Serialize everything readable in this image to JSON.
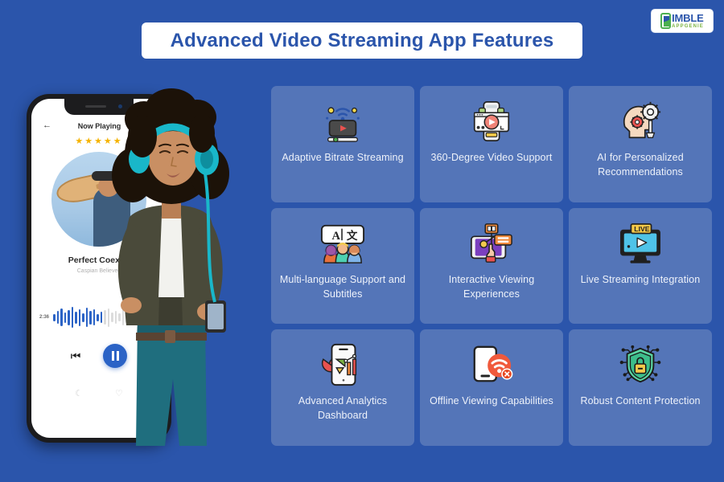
{
  "page": {
    "background_color": "#2B55AB",
    "card_color": "#5475B8",
    "accent_color": "#2B63C6"
  },
  "logo": {
    "name": "nimble-appgenie-logo",
    "main_text": "IMBLE",
    "sub_text": "APPGENIE",
    "icon": "phone-n-icon"
  },
  "header": {
    "title": "Advanced Video Streaming App Features"
  },
  "phone": {
    "topbar": {
      "back_icon": "back-arrow-icon",
      "back_glyph": "←",
      "title": "Now Playing",
      "favorite_icon": "heart-outline-icon",
      "favorite_glyph": "♡"
    },
    "rating": {
      "stars": "★★★★★",
      "count": 5
    },
    "song": {
      "title": "Perfect Coexist",
      "artist": "Caspian Believed"
    },
    "progress": {
      "elapsed": "2:36"
    },
    "controls": {
      "previous_icon": "previous-track-icon",
      "previous_glyph": "⏮",
      "play_icon": "pause-icon"
    },
    "bottom": {
      "moon_icon": "moon-icon",
      "moon_glyph": "☾",
      "heart_icon": "heart-outline-icon",
      "heart_glyph": "♡"
    }
  },
  "features": [
    {
      "id": "adaptive-bitrate-streaming",
      "label": "Adaptive Bitrate Streaming",
      "icon": "screen-wifi-play-icon"
    },
    {
      "id": "360-degree-video-support",
      "label": "360-Degree Video Support",
      "icon": "phone-video-window-icon"
    },
    {
      "id": "ai-for-personalized-recommendations",
      "label": "AI for Personalized Recommendations",
      "icon": "head-gears-icon"
    },
    {
      "id": "multi-language-support-and-subtitles",
      "label": "Multi-language Support and Subtitles",
      "icon": "speech-bubble-people-icon"
    },
    {
      "id": "interactive-viewing-experiences",
      "label": "Interactive Viewing Experiences",
      "icon": "tablet-hand-touch-icon"
    },
    {
      "id": "live-streaming-integration",
      "label": "Live Streaming Integration",
      "icon": "monitor-live-badge-icon"
    },
    {
      "id": "advanced-analytics-dashboard",
      "label": "Advanced Analytics Dashboard",
      "icon": "phone-charts-icon"
    },
    {
      "id": "offline-viewing-capabilities",
      "label": "Offline Viewing Capabilities",
      "icon": "phone-wifi-off-icon"
    },
    {
      "id": "robust-content-protection",
      "label": "Robust Content Protection",
      "icon": "shield-lock-circuit-icon"
    }
  ]
}
